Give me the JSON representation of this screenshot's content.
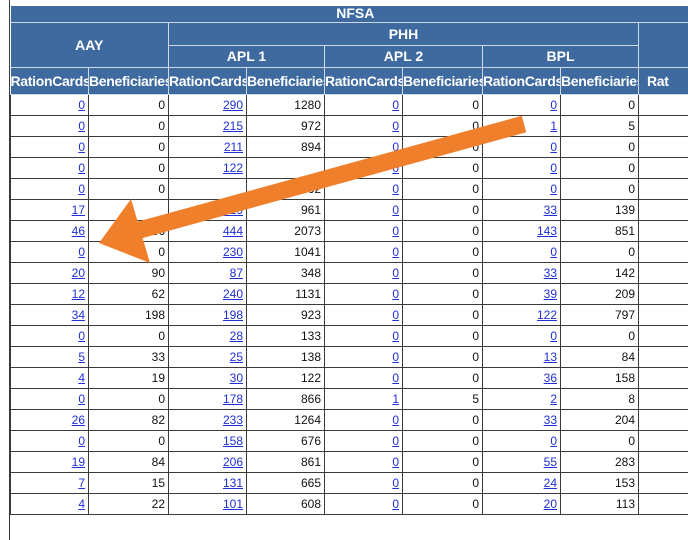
{
  "header": {
    "top_label": "NFSA",
    "aay": "AAY",
    "phh": "PHH",
    "apl1": "APL 1",
    "apl2": "APL 2",
    "bpl": "BPL",
    "col_rationcards": "RationCards",
    "col_beneficiaries": "Beneficiaries",
    "col_partial": "Rat"
  },
  "rows": [
    {
      "aay_rc": "0",
      "aay_ben": "0",
      "apl1_rc": "290",
      "apl1_ben": "1280",
      "apl2_rc": "0",
      "apl2_ben": "0",
      "bpl_rc": "0",
      "bpl_ben": "0"
    },
    {
      "aay_rc": "0",
      "aay_ben": "0",
      "apl1_rc": "215",
      "apl1_ben": "972",
      "apl2_rc": "0",
      "apl2_ben": "0",
      "bpl_rc": "1",
      "bpl_ben": "5"
    },
    {
      "aay_rc": "0",
      "aay_ben": "0",
      "apl1_rc": "211",
      "apl1_ben": "894",
      "apl2_rc": "0",
      "apl2_ben": "0",
      "bpl_rc": "0",
      "bpl_ben": "0"
    },
    {
      "aay_rc": "0",
      "aay_ben": "0",
      "apl1_rc": "122",
      "apl1_ben": "",
      "apl2_rc": "0",
      "apl2_ben": "0",
      "bpl_rc": "0",
      "bpl_ben": "0"
    },
    {
      "aay_rc": "0",
      "aay_ben": "0",
      "apl1_rc": "",
      "apl1_ben": "662",
      "apl2_rc": "0",
      "apl2_ben": "0",
      "bpl_rc": "0",
      "bpl_ben": "0"
    },
    {
      "aay_rc": "17",
      "aay_ben": "",
      "apl1_rc": "219",
      "apl1_ben": "961",
      "apl2_rc": "0",
      "apl2_ben": "0",
      "bpl_rc": "33",
      "bpl_ben": "139"
    },
    {
      "aay_rc": "46",
      "aay_ben": "186",
      "apl1_rc": "444",
      "apl1_ben": "2073",
      "apl2_rc": "0",
      "apl2_ben": "0",
      "bpl_rc": "143",
      "bpl_ben": "851"
    },
    {
      "aay_rc": "0",
      "aay_ben": "0",
      "apl1_rc": "230",
      "apl1_ben": "1041",
      "apl2_rc": "0",
      "apl2_ben": "0",
      "bpl_rc": "0",
      "bpl_ben": "0"
    },
    {
      "aay_rc": "20",
      "aay_ben": "90",
      "apl1_rc": "87",
      "apl1_ben": "348",
      "apl2_rc": "0",
      "apl2_ben": "0",
      "bpl_rc": "33",
      "bpl_ben": "142"
    },
    {
      "aay_rc": "12",
      "aay_ben": "62",
      "apl1_rc": "240",
      "apl1_ben": "1131",
      "apl2_rc": "0",
      "apl2_ben": "0",
      "bpl_rc": "39",
      "bpl_ben": "209"
    },
    {
      "aay_rc": "34",
      "aay_ben": "198",
      "apl1_rc": "198",
      "apl1_ben": "923",
      "apl2_rc": "0",
      "apl2_ben": "0",
      "bpl_rc": "122",
      "bpl_ben": "797"
    },
    {
      "aay_rc": "0",
      "aay_ben": "0",
      "apl1_rc": "28",
      "apl1_ben": "133",
      "apl2_rc": "0",
      "apl2_ben": "0",
      "bpl_rc": "0",
      "bpl_ben": "0"
    },
    {
      "aay_rc": "5",
      "aay_ben": "33",
      "apl1_rc": "25",
      "apl1_ben": "138",
      "apl2_rc": "0",
      "apl2_ben": "0",
      "bpl_rc": "13",
      "bpl_ben": "84"
    },
    {
      "aay_rc": "4",
      "aay_ben": "19",
      "apl1_rc": "30",
      "apl1_ben": "122",
      "apl2_rc": "0",
      "apl2_ben": "0",
      "bpl_rc": "36",
      "bpl_ben": "158"
    },
    {
      "aay_rc": "0",
      "aay_ben": "0",
      "apl1_rc": "178",
      "apl1_ben": "866",
      "apl2_rc": "1",
      "apl2_ben": "5",
      "bpl_rc": "2",
      "bpl_ben": "8"
    },
    {
      "aay_rc": "26",
      "aay_ben": "82",
      "apl1_rc": "233",
      "apl1_ben": "1264",
      "apl2_rc": "0",
      "apl2_ben": "0",
      "bpl_rc": "33",
      "bpl_ben": "204"
    },
    {
      "aay_rc": "0",
      "aay_ben": "0",
      "apl1_rc": "158",
      "apl1_ben": "676",
      "apl2_rc": "0",
      "apl2_ben": "0",
      "bpl_rc": "0",
      "bpl_ben": "0"
    },
    {
      "aay_rc": "19",
      "aay_ben": "84",
      "apl1_rc": "206",
      "apl1_ben": "861",
      "apl2_rc": "0",
      "apl2_ben": "0",
      "bpl_rc": "55",
      "bpl_ben": "283"
    },
    {
      "aay_rc": "7",
      "aay_ben": "15",
      "apl1_rc": "131",
      "apl1_ben": "665",
      "apl2_rc": "0",
      "apl2_ben": "0",
      "bpl_rc": "24",
      "bpl_ben": "153"
    },
    {
      "aay_rc": "4",
      "aay_ben": "22",
      "apl1_rc": "101",
      "apl1_ben": "608",
      "apl2_rc": "0",
      "apl2_ben": "0",
      "bpl_rc": "20",
      "bpl_ben": "113"
    }
  ],
  "annotation": {
    "arrow_icon": "arrow-annotation-icon",
    "arrow_color": "#f07f2c"
  },
  "colors": {
    "header_bg": "#3e6aa0",
    "link": "#1f2fd6"
  }
}
